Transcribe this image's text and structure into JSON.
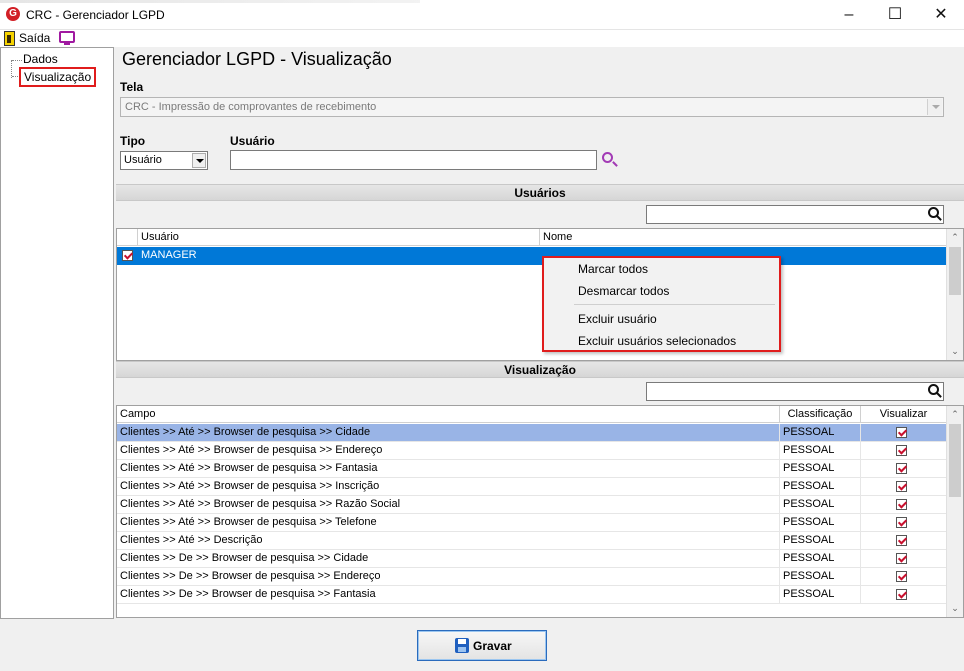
{
  "window": {
    "title": "CRC - Gerenciador LGPD",
    "logo_letter": "G"
  },
  "menu": {
    "exit_label": "Saída"
  },
  "tree": {
    "items": [
      "Dados",
      "Visualização"
    ]
  },
  "page_title": "Gerenciador LGPD - Visualização",
  "tela": {
    "label": "Tela",
    "value": "CRC - Impressão de comprovantes de recebimento"
  },
  "tipo": {
    "label": "Tipo",
    "value": "Usuário"
  },
  "usuario": {
    "label": "Usuário",
    "value": ""
  },
  "users_section": {
    "title": "Usuários",
    "filter_value": "",
    "columns": [
      "Usuário",
      "Nome"
    ],
    "rows": [
      {
        "checked": true,
        "usuario": "MANAGER",
        "nome": ""
      }
    ]
  },
  "context_menu": {
    "items": [
      "Marcar todos",
      "Desmarcar todos",
      "Excluir usuário",
      "Excluir usuários selecionados"
    ]
  },
  "view_section": {
    "title": "Visualização",
    "filter_value": "",
    "columns": [
      "Campo",
      "Classificação",
      "Visualizar"
    ],
    "rows": [
      {
        "campo": "Clientes >> Até >> Browser de pesquisa >> Cidade",
        "classificacao": "PESSOAL",
        "visualizar": true
      },
      {
        "campo": "Clientes >> Até >> Browser de pesquisa >> Endereço",
        "classificacao": "PESSOAL",
        "visualizar": true
      },
      {
        "campo": "Clientes >> Até >> Browser de pesquisa >> Fantasia",
        "classificacao": "PESSOAL",
        "visualizar": true
      },
      {
        "campo": "Clientes >> Até >> Browser de pesquisa >> Inscrição",
        "classificacao": "PESSOAL",
        "visualizar": true
      },
      {
        "campo": "Clientes >> Até >> Browser de pesquisa >> Razão Social",
        "classificacao": "PESSOAL",
        "visualizar": true
      },
      {
        "campo": "Clientes >> Até >> Browser de pesquisa >> Telefone",
        "classificacao": "PESSOAL",
        "visualizar": true
      },
      {
        "campo": "Clientes >> Até >> Descrição",
        "classificacao": "PESSOAL",
        "visualizar": true
      },
      {
        "campo": "Clientes >> De >> Browser de pesquisa >> Cidade",
        "classificacao": "PESSOAL",
        "visualizar": true
      },
      {
        "campo": "Clientes >> De >> Browser de pesquisa >> Endereço",
        "classificacao": "PESSOAL",
        "visualizar": true
      },
      {
        "campo": "Clientes >> De >> Browser de pesquisa >> Fantasia",
        "classificacao": "PESSOAL",
        "visualizar": true
      }
    ]
  },
  "save_button": {
    "label": "Gravar"
  },
  "colors": {
    "selection_blue": "#0078d7",
    "row_selected": "#99b4e6",
    "accent_red": "#e01c1c",
    "accent_purple": "#a23ab5"
  }
}
